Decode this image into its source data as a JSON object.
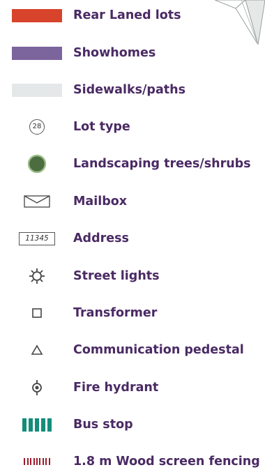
{
  "colors": {
    "label": "#4a2a64",
    "rear_laned": "#d8432b",
    "showhomes": "#7c649c",
    "sidewalks": "#e5e8e8",
    "tree_fill": "#4b6d40",
    "tree_stroke": "#9dbf8a",
    "bus": "#138d7a",
    "fence": "#9b1b2c",
    "symbol_stroke": "#444444"
  },
  "compass_icon": "north-arrow-icon",
  "legend": {
    "items": [
      {
        "key": "rear-laned-lots",
        "label": "Rear Laned lots",
        "icon": "red-swatch"
      },
      {
        "key": "showhomes",
        "label": "Showhomes",
        "icon": "purple-swatch"
      },
      {
        "key": "sidewalks-paths",
        "label": "Sidewalks/paths",
        "icon": "grey-swatch"
      },
      {
        "key": "lot-type",
        "label": "Lot type",
        "icon": "circled-number-icon",
        "symbol_text": "28"
      },
      {
        "key": "landscaping",
        "label": "Landscaping trees/shrubs",
        "icon": "tree-icon"
      },
      {
        "key": "mailbox",
        "label": "Mailbox",
        "icon": "envelope-icon"
      },
      {
        "key": "address",
        "label": "Address",
        "icon": "address-box-icon",
        "symbol_text": "11345"
      },
      {
        "key": "street-lights",
        "label": "Street lights",
        "icon": "sun-icon"
      },
      {
        "key": "transformer",
        "label": "Transformer",
        "icon": "square-icon"
      },
      {
        "key": "communication-pedestal",
        "label": "Communication pedestal",
        "icon": "triangle-icon"
      },
      {
        "key": "fire-hydrant",
        "label": "Fire hydrant",
        "icon": "hydrant-icon"
      },
      {
        "key": "bus-stop",
        "label": "Bus stop",
        "icon": "bars-icon"
      },
      {
        "key": "wood-fencing",
        "label": "1.8 m Wood screen fencing",
        "icon": "fence-icon"
      }
    ]
  }
}
